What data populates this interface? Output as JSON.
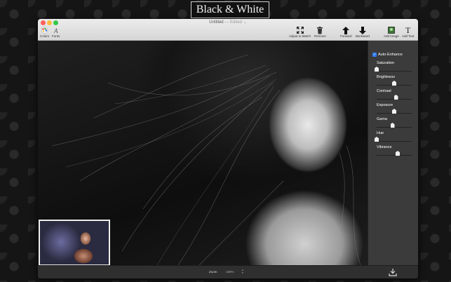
{
  "app_title": "Black & White",
  "window": {
    "doc_title": "Untitled",
    "doc_sep": " — ",
    "doc_status": "Edited",
    "doc_chevron": "⌄"
  },
  "toolbar": {
    "colors_label": "Colors",
    "fonts_label": "Fonts",
    "adjust_label": "Adjust to Match",
    "remove_label": "Remove",
    "forward_label": "Forward",
    "backward_label": "Backward",
    "add_image_label": "Add Image",
    "add_text_label": "Add Text",
    "add_text_glyph": "T"
  },
  "panel": {
    "auto_enhance": {
      "label": "Auto-Enhance",
      "checked": true
    },
    "sliders": [
      {
        "label": "Saturation",
        "value": 0.0
      },
      {
        "label": "Brightness",
        "value": 0.5
      },
      {
        "label": "Contrast",
        "value": 0.55
      },
      {
        "label": "Exposure",
        "value": 0.5
      },
      {
        "label": "Gama",
        "value": 0.45
      },
      {
        "label": "Hue",
        "value": 0.0
      },
      {
        "label": "Vibrance",
        "value": 0.6
      }
    ]
  },
  "statusbar": {
    "zoom_label": "Zoom",
    "zoom_value": "100%"
  },
  "colors": {
    "accent": "#2d7cf6",
    "close": "#fc605b",
    "minimize": "#fdbc40",
    "maximize": "#34c84a"
  }
}
